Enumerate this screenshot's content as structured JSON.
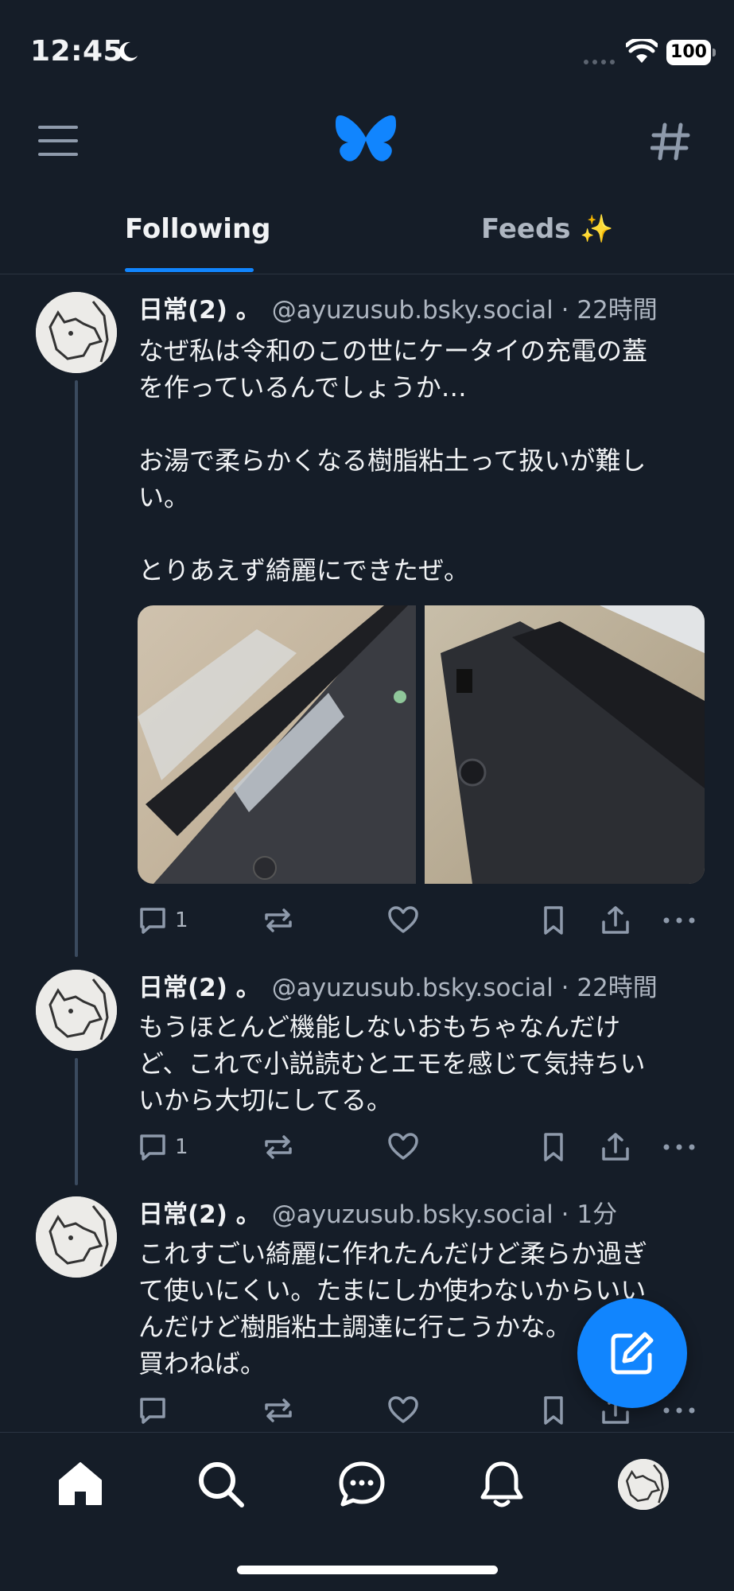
{
  "status_bar": {
    "time": "12:45",
    "battery": "100"
  },
  "tabs": [
    {
      "label": "Following",
      "active": true
    },
    {
      "label": "Feeds ✨",
      "active": false
    }
  ],
  "posts": [
    {
      "author": "日常(2) 。",
      "handle": "@ayuzusub.bsky.social",
      "separator": "·",
      "time": "22時間",
      "text": "なぜ私は令和のこの世にケータイの充電の蓋\nを作っているんでしょうか…\n\nお湯で柔らかくなる樹脂粘土って扱いが難し\nい。\n\nとりあえず綺麗にできたぜ。",
      "reply_count": "1"
    },
    {
      "author": "日常(2) 。",
      "handle": "@ayuzusub.bsky.social",
      "separator": "·",
      "time": "22時間",
      "text": "もうほとんど機能しないおもちゃなんだけ\nど、これで小説読むとエモを感じて気持ちい\nいから大切にしてる。",
      "reply_count": "1"
    },
    {
      "author": "日常(2) 。",
      "handle": "@ayuzusub.bsky.social",
      "separator": "·",
      "time": "1分",
      "text": "これすごい綺麗に作れたんだけど柔らか過ぎ\nて使いにくい。たまにしか使わないからいい\nんだけど樹脂粘土調達に行こうかな。\n買わねば。",
      "reply_count": ""
    }
  ],
  "colors": {
    "background": "#151d28",
    "accent": "#1185fe",
    "muted": "#aeb6c1",
    "thread_line": "#3a4a5e"
  },
  "icons": {
    "header": [
      "menu-icon",
      "bluesky-butterfly-icon",
      "hashtag-icon"
    ],
    "post_actions": [
      "reply-icon",
      "repost-icon",
      "like-icon",
      "bookmark-icon",
      "share-icon",
      "more-icon"
    ],
    "nav": [
      "home-icon",
      "search-icon",
      "chat-icon",
      "notifications-icon",
      "profile-avatar"
    ],
    "fab": "compose-icon"
  }
}
